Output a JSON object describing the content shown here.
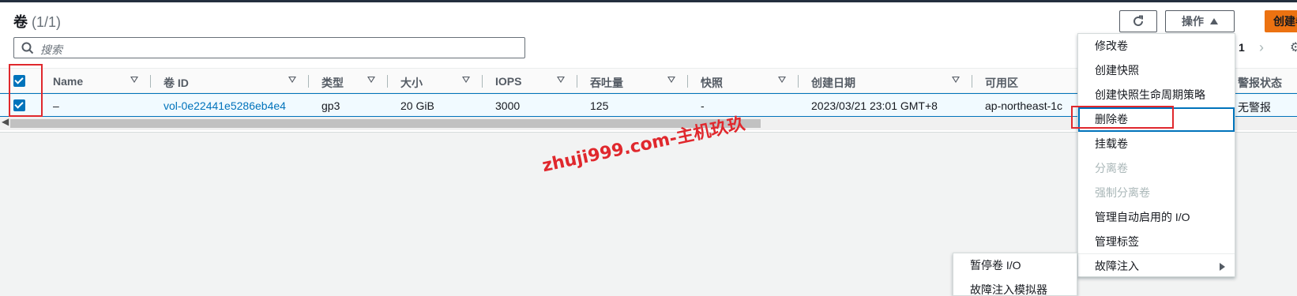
{
  "header": {
    "title": "卷",
    "count": "(1/1)",
    "refresh_icon": "refresh-icon",
    "actions_label": "操作",
    "create_label": "创建卷"
  },
  "search": {
    "placeholder": "搜索"
  },
  "pagination": {
    "current_page": "1"
  },
  "table": {
    "columns": [
      "Name",
      "卷 ID",
      "类型",
      "大小",
      "IOPS",
      "吞吐量",
      "快照",
      "创建日期",
      "可用区",
      "警报状态"
    ],
    "rows": [
      {
        "name": "–",
        "volume_id": "vol-0e22441e5286eb4e4",
        "type": "gp3",
        "size": "20 GiB",
        "iops": "3000",
        "throughput": "125",
        "snapshot": "-",
        "created": "2023/03/21 23:01 GMT+8",
        "az": "ap-northeast-1c",
        "alarm": "无警报"
      }
    ]
  },
  "actions_menu": {
    "items": [
      {
        "label": "修改卷",
        "enabled": true
      },
      {
        "label": "创建快照",
        "enabled": true
      },
      {
        "label": "创建快照生命周期策略",
        "enabled": true
      },
      {
        "label": "删除卷",
        "enabled": true
      },
      {
        "label": "挂载卷",
        "enabled": true
      },
      {
        "label": "分离卷",
        "enabled": false
      },
      {
        "label": "强制分离卷",
        "enabled": false
      },
      {
        "label": "管理自动启用的 I/O",
        "enabled": true
      },
      {
        "label": "管理标签",
        "enabled": true
      },
      {
        "label": "故障注入",
        "enabled": true
      }
    ]
  },
  "fault_submenu": {
    "items": [
      {
        "label": "暂停卷 I/O"
      },
      {
        "label": "故障注入模拟器"
      }
    ]
  },
  "watermark": "zhuji999.com-主机玖玖",
  "colors": {
    "primary": "#ec7211",
    "link": "#0073bb",
    "highlight": "#e0282d",
    "selected_row": "#f1faff"
  }
}
